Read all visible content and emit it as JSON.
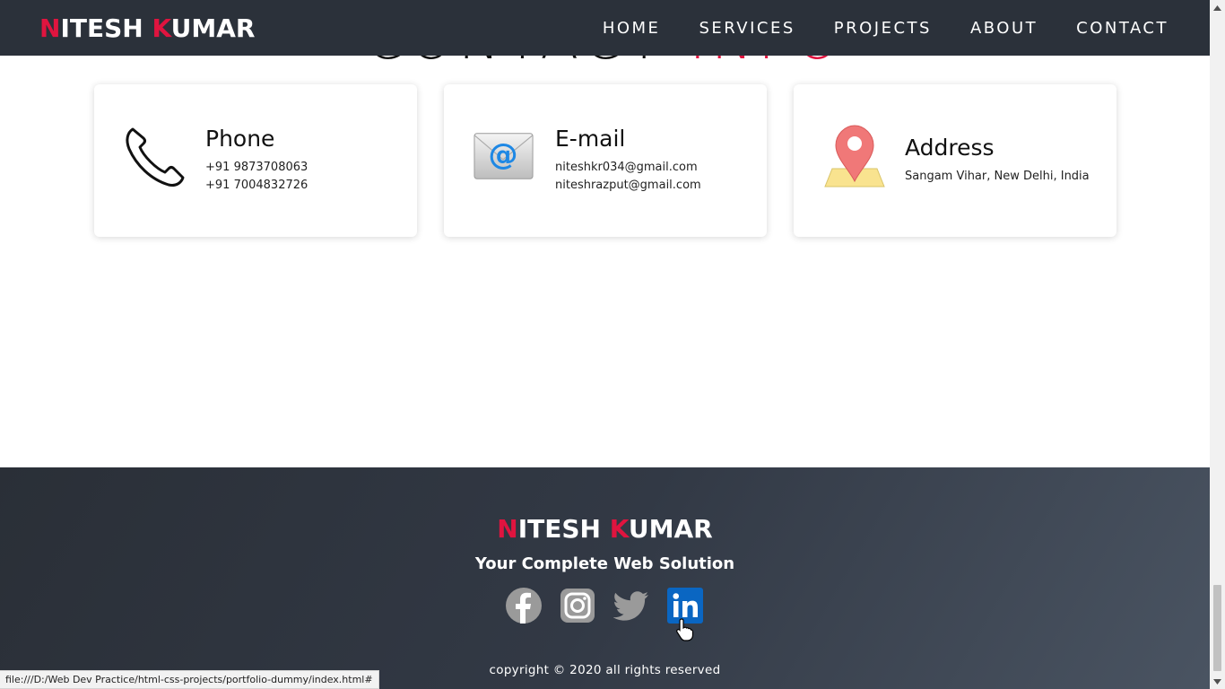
{
  "heading": {
    "main": "CONTACT",
    "accent": "INFO"
  },
  "brand": {
    "first_initial": "N",
    "first_rest": "ITESH ",
    "last_initial": "K",
    "last_rest": "UMAR"
  },
  "nav": {
    "items": [
      {
        "label": "HOME"
      },
      {
        "label": "SERVICES"
      },
      {
        "label": "PROJECTS"
      },
      {
        "label": "ABOUT"
      },
      {
        "label": "CONTACT"
      }
    ]
  },
  "contact": {
    "phone": {
      "title": "Phone",
      "lines": [
        "+91 9873708063",
        "+91 7004832726"
      ],
      "icon": "phone-icon"
    },
    "email": {
      "title": "E-mail",
      "lines": [
        "niteshkr034@gmail.com",
        "niteshrazput@gmail.com"
      ],
      "icon": "email-icon"
    },
    "address": {
      "title": "Address",
      "lines": [
        "Sangam Vihar, New Delhi, India"
      ],
      "icon": "map-pin-icon"
    }
  },
  "footer": {
    "tagline": "Your Complete Web Solution",
    "socials": [
      "facebook-icon",
      "instagram-icon",
      "twitter-icon",
      "linkedin-icon"
    ],
    "copyright": "copyright © 2020 all rights reserved"
  },
  "statusbar": {
    "url": "file:///D:/Web Dev Practice/html-css-projects/portfolio-dummy/index.html#"
  },
  "colors": {
    "accent": "#e0143f",
    "navbar": "#2b313a",
    "linkedin": "#0a66c2"
  }
}
